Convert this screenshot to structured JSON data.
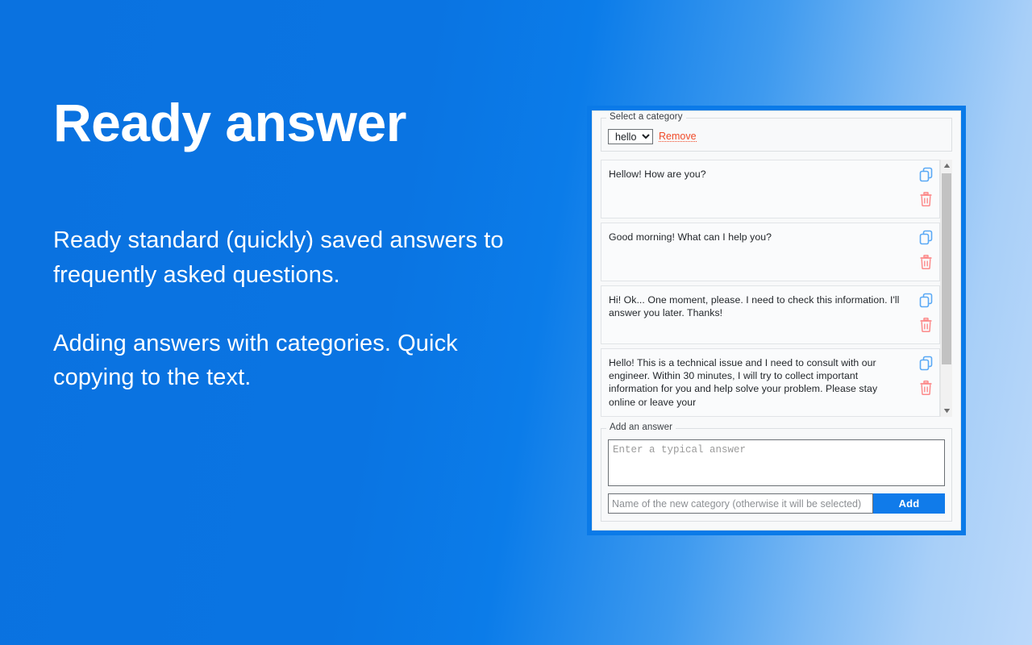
{
  "promo": {
    "title": "Ready answer",
    "paragraphs": [
      "Ready standard (quickly) saved answers to frequently asked questions.",
      "Adding answers with categories. Quick copying to the text."
    ]
  },
  "theme": {
    "background_start": "#0a72e0",
    "background_end": "#bcd9fa",
    "panel_border": "#0a7ae8",
    "panel_background": "#f8f9fa",
    "accent_button": "#107bea",
    "remove_link": "#f04a28",
    "copy_icon": "#5aa9f5",
    "trash_icon": "#fc8a8a"
  },
  "panel": {
    "category_group": {
      "legend": "Select a category",
      "selected": "hello",
      "options": [
        "hello"
      ],
      "remove_label": "Remove"
    },
    "answers": [
      {
        "text": "Hellow! How are you?",
        "copy_icon": "copy-icon",
        "delete_icon": "trash-icon"
      },
      {
        "text": "Good morning! What can I help you?",
        "copy_icon": "copy-icon",
        "delete_icon": "trash-icon"
      },
      {
        "text": "Hi! Ok... One moment, please. I need to check this information. I'll answer you later. Thanks!",
        "copy_icon": "copy-icon",
        "delete_icon": "trash-icon"
      },
      {
        "text": "Hello! This is a technical issue and I need to consult with our engineer. Within 30 minutes, I will try to collect important information for you and help solve your problem. Please stay online or leave your",
        "copy_icon": "copy-icon",
        "delete_icon": "trash-icon"
      }
    ],
    "scrollbar": {
      "up_arrow": "triangle-up-icon",
      "down_arrow": "triangle-down-icon"
    },
    "add_group": {
      "legend": "Add an answer",
      "answer_placeholder": "Enter a typical answer",
      "answer_value": "",
      "category_placeholder": "Name of the new category (otherwise it will be selected)",
      "category_value": "",
      "add_label": "Add"
    }
  }
}
